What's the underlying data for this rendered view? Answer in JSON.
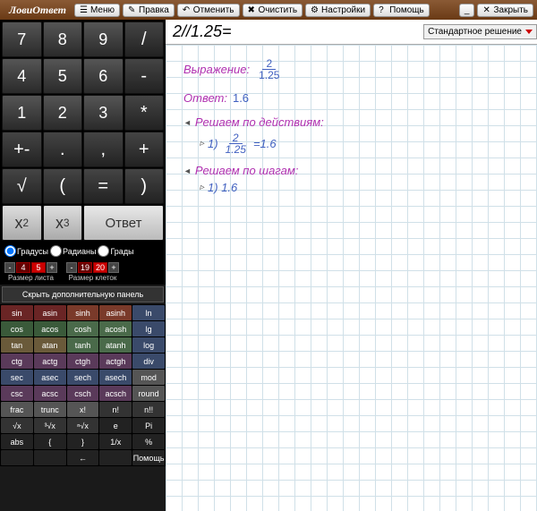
{
  "app": {
    "name": "ЛовиОтвет"
  },
  "menu": {
    "items": [
      "Меню",
      "Правка",
      "Отменить",
      "Очистить",
      "Настройки",
      "Помощь"
    ],
    "close": "Закрыть"
  },
  "keypad": {
    "r1": [
      "7",
      "8",
      "9",
      "/"
    ],
    "r2": [
      "4",
      "5",
      "6",
      "-"
    ],
    "r3": [
      "1",
      "2",
      "3",
      "*"
    ],
    "r4": [
      "+-",
      ".",
      ",",
      "+"
    ],
    "r5": [
      "√",
      "(",
      "=",
      ")"
    ],
    "r6": [
      "x²",
      "x³",
      "Ответ"
    ]
  },
  "radios": {
    "deg": "Градусы",
    "rad": "Радианы",
    "grad": "Грады"
  },
  "sliders": {
    "sheet": {
      "label": "Размер листа",
      "v1": "4",
      "v2": "5"
    },
    "cell": {
      "label": "Размер клеток",
      "v1": "19",
      "v2": "20"
    }
  },
  "hidepanel": "Скрыть дополнительную панель",
  "func": [
    [
      "sin",
      "asin",
      "sinh",
      "asinh",
      "ln"
    ],
    [
      "cos",
      "acos",
      "cosh",
      "acosh",
      "lg"
    ],
    [
      "tan",
      "atan",
      "tanh",
      "atanh",
      "log"
    ],
    [
      "ctg",
      "actg",
      "ctgh",
      "actgh",
      "div"
    ],
    [
      "sec",
      "asec",
      "sech",
      "asech",
      "mod"
    ],
    [
      "csc",
      "acsc",
      "csch",
      "acsch",
      "round"
    ],
    [
      "frac",
      "trunc",
      "x!",
      "n!",
      "n!!"
    ],
    [
      "√x",
      "³√x",
      "ⁿ√x",
      "e",
      "Pi"
    ],
    [
      "abs",
      "{",
      "}",
      "1/x",
      "%"
    ],
    [
      "",
      "",
      "←",
      "",
      "Помощь"
    ]
  ],
  "input": {
    "expr": "2//1.25=",
    "mode": "Стандартное решение"
  },
  "solution": {
    "exprLabel": "Выражение:",
    "exprNum": "2",
    "exprDen": "1.25",
    "ansLabel": "Ответ:",
    "ansVal": "1.6",
    "sect1": "Решаем по действиям:",
    "s1": "1)",
    "s1num": "2",
    "s1den": "1.25",
    "s1res": "=1.6",
    "sect2": "Решаем по шагам:",
    "s2": "1) 1.6"
  }
}
